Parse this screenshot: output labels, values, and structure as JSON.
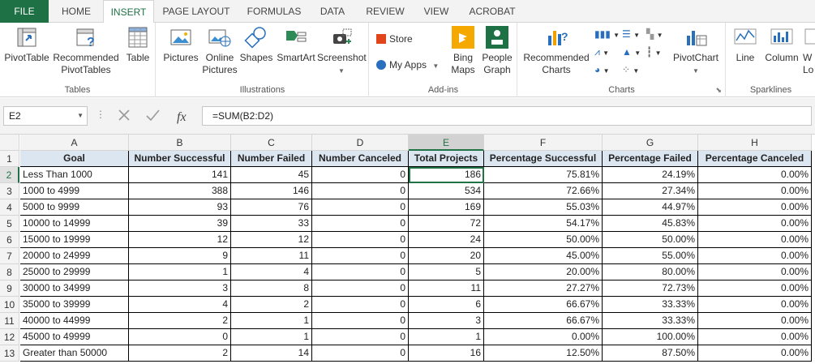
{
  "tabs": [
    "FILE",
    "HOME",
    "INSERT",
    "PAGE LAYOUT",
    "FORMULAS",
    "DATA",
    "REVIEW",
    "VIEW",
    "ACROBAT"
  ],
  "ribbon": {
    "groups": {
      "tables": "Tables",
      "illustrations": "Illustrations",
      "addins": "Add-ins",
      "charts": "Charts",
      "sparklines": "Sparklines"
    },
    "buttons": {
      "pivottable": "PivotTable",
      "rec_pivot_1": "Recommended",
      "rec_pivot_2": "PivotTables",
      "table": "Table",
      "pictures": "Pictures",
      "online_1": "Online",
      "online_2": "Pictures",
      "shapes": "Shapes",
      "smartart": "SmartArt",
      "screenshot": "Screenshot",
      "store": "Store",
      "myapps": "My Apps",
      "bing_1": "Bing",
      "bing_2": "Maps",
      "people_1": "People",
      "people_2": "Graph",
      "rec_charts_1": "Recommended",
      "rec_charts_2": "Charts",
      "pivotchart": "PivotChart",
      "line": "Line",
      "column": "Column",
      "winloss_1": "W",
      "winloss_2": "Lo"
    }
  },
  "formula_bar": {
    "name_box": "E2",
    "formula": "=SUM(B2:D2)"
  },
  "sheet": {
    "columns": [
      "A",
      "B",
      "C",
      "D",
      "E",
      "F",
      "G",
      "H"
    ],
    "selected_column": "E",
    "selected_row": 2,
    "headers": [
      "Goal",
      "Number Successful",
      "Number Failed",
      "Number Canceled",
      "Total Projects",
      "Percentage Successful",
      "Percentage Failed",
      "Percentage Canceled"
    ],
    "rows": [
      [
        "Less Than 1000",
        "141",
        "45",
        "0",
        "186",
        "75.81%",
        "24.19%",
        "0.00%"
      ],
      [
        "1000 to 4999",
        "388",
        "146",
        "0",
        "534",
        "72.66%",
        "27.34%",
        "0.00%"
      ],
      [
        "5000 to 9999",
        "93",
        "76",
        "0",
        "169",
        "55.03%",
        "44.97%",
        "0.00%"
      ],
      [
        "10000 to 14999",
        "39",
        "33",
        "0",
        "72",
        "54.17%",
        "45.83%",
        "0.00%"
      ],
      [
        "15000 to 19999",
        "12",
        "12",
        "0",
        "24",
        "50.00%",
        "50.00%",
        "0.00%"
      ],
      [
        "20000 to 24999",
        "9",
        "11",
        "0",
        "20",
        "45.00%",
        "55.00%",
        "0.00%"
      ],
      [
        "25000 to 29999",
        "1",
        "4",
        "0",
        "5",
        "20.00%",
        "80.00%",
        "0.00%"
      ],
      [
        "30000 to 34999",
        "3",
        "8",
        "0",
        "11",
        "27.27%",
        "72.73%",
        "0.00%"
      ],
      [
        "35000 to 39999",
        "4",
        "2",
        "0",
        "6",
        "66.67%",
        "33.33%",
        "0.00%"
      ],
      [
        "40000 to 44999",
        "2",
        "1",
        "0",
        "3",
        "66.67%",
        "33.33%",
        "0.00%"
      ],
      [
        "45000 to 49999",
        "0",
        "1",
        "0",
        "1",
        "0.00%",
        "100.00%",
        "0.00%"
      ],
      [
        "Greater than 50000",
        "2",
        "14",
        "0",
        "16",
        "12.50%",
        "87.50%",
        "0.00%"
      ]
    ]
  }
}
